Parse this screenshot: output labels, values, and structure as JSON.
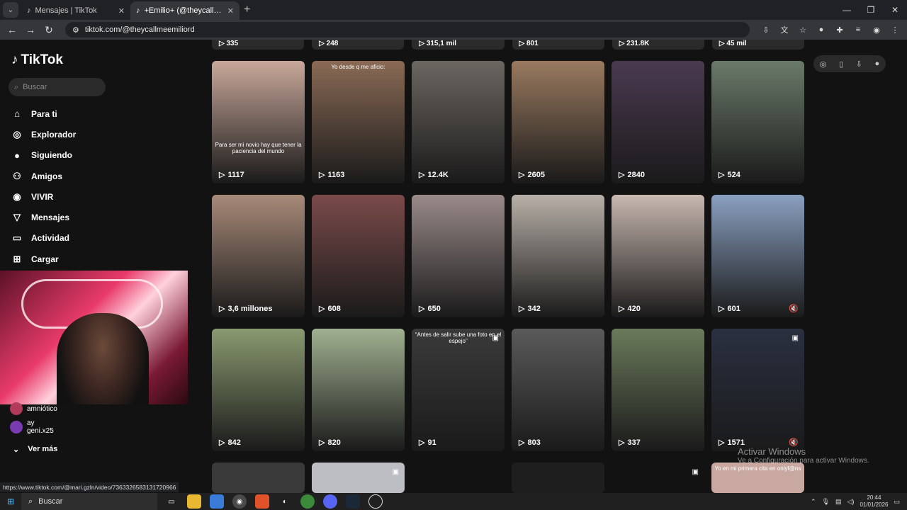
{
  "browser": {
    "tabs": [
      {
        "label": "Mensajes | TikTok",
        "active": false
      },
      {
        "label": "+Emilio+ (@theycallmeemiliord)",
        "active": true
      }
    ],
    "url": "tiktok.com/@theycallmeemiliord",
    "status_url": "https://www.tiktok.com/@mari.gzln/video/7363326583131720966"
  },
  "sidebar": {
    "logo": "TikTok",
    "search_placeholder": "Buscar",
    "items": [
      {
        "label": "Para ti",
        "icon": "home-icon"
      },
      {
        "label": "Explorador",
        "icon": "compass-icon"
      },
      {
        "label": "Siguiendo",
        "icon": "following-avatar-icon"
      },
      {
        "label": "Amigos",
        "icon": "friends-icon"
      },
      {
        "label": "VIVIR",
        "icon": "live-icon"
      },
      {
        "label": "Mensajes",
        "icon": "messages-icon"
      },
      {
        "label": "Actividad",
        "icon": "activity-icon"
      },
      {
        "label": "Cargar",
        "icon": "upload-icon"
      }
    ],
    "following": [
      {
        "line1": "amniótico"
      },
      {
        "line1": "ay",
        "line2": "geni.x25"
      }
    ],
    "ver_mas": "Ver más"
  },
  "top_row_views": [
    "335",
    "248",
    "315,1 mil",
    "801",
    "231.8K",
    "45 mil"
  ],
  "videos": [
    {
      "views": "1117",
      "caption": "Para ser mi novio hay que tener la paciencia del mundo",
      "color": "#c9a89a"
    },
    {
      "views": "1163",
      "caption_top": "Yo desde q me aficio:",
      "color": "#8a6a55"
    },
    {
      "views": "12.4K",
      "color": "#6b6660"
    },
    {
      "views": "2605",
      "color": "#9a7a60"
    },
    {
      "views": "2840",
      "color": "#4a3a50"
    },
    {
      "views": "524",
      "color": "#6a7a6a"
    },
    {
      "views": "3,6 millones",
      "color": "#a88a78"
    },
    {
      "views": "608",
      "color": "#7a4a4a"
    },
    {
      "views": "650",
      "color": "#9a8a8a"
    },
    {
      "views": "342",
      "color": "#b8b0a8"
    },
    {
      "views": "420",
      "color": "#c8b8b0"
    },
    {
      "views": "601",
      "color": "#8aa0c0",
      "muted": true
    },
    {
      "views": "842",
      "color": "#8a9a70"
    },
    {
      "views": "820",
      "color": "#a0b090"
    },
    {
      "views": "91",
      "color": "#3a3a3a",
      "caption_top": "“Antes de salir sube una foto en el espejo”",
      "badge": true
    },
    {
      "views": "803",
      "color": "#5a5a5a"
    },
    {
      "views": "337",
      "color": "#6a7a5a"
    },
    {
      "views": "1571",
      "color": "#2a3040",
      "badge": true,
      "muted": true
    }
  ],
  "bottom_partial": [
    {
      "caption": "Yo en mi primera cita en onlyf@ns"
    }
  ],
  "windows": {
    "activate_title": "Activar Windows",
    "activate_sub": "Ve a Configuración para activar Windows.",
    "taskbar_search": "Buscar",
    "time": "20:44",
    "date": "01/01/2026"
  }
}
